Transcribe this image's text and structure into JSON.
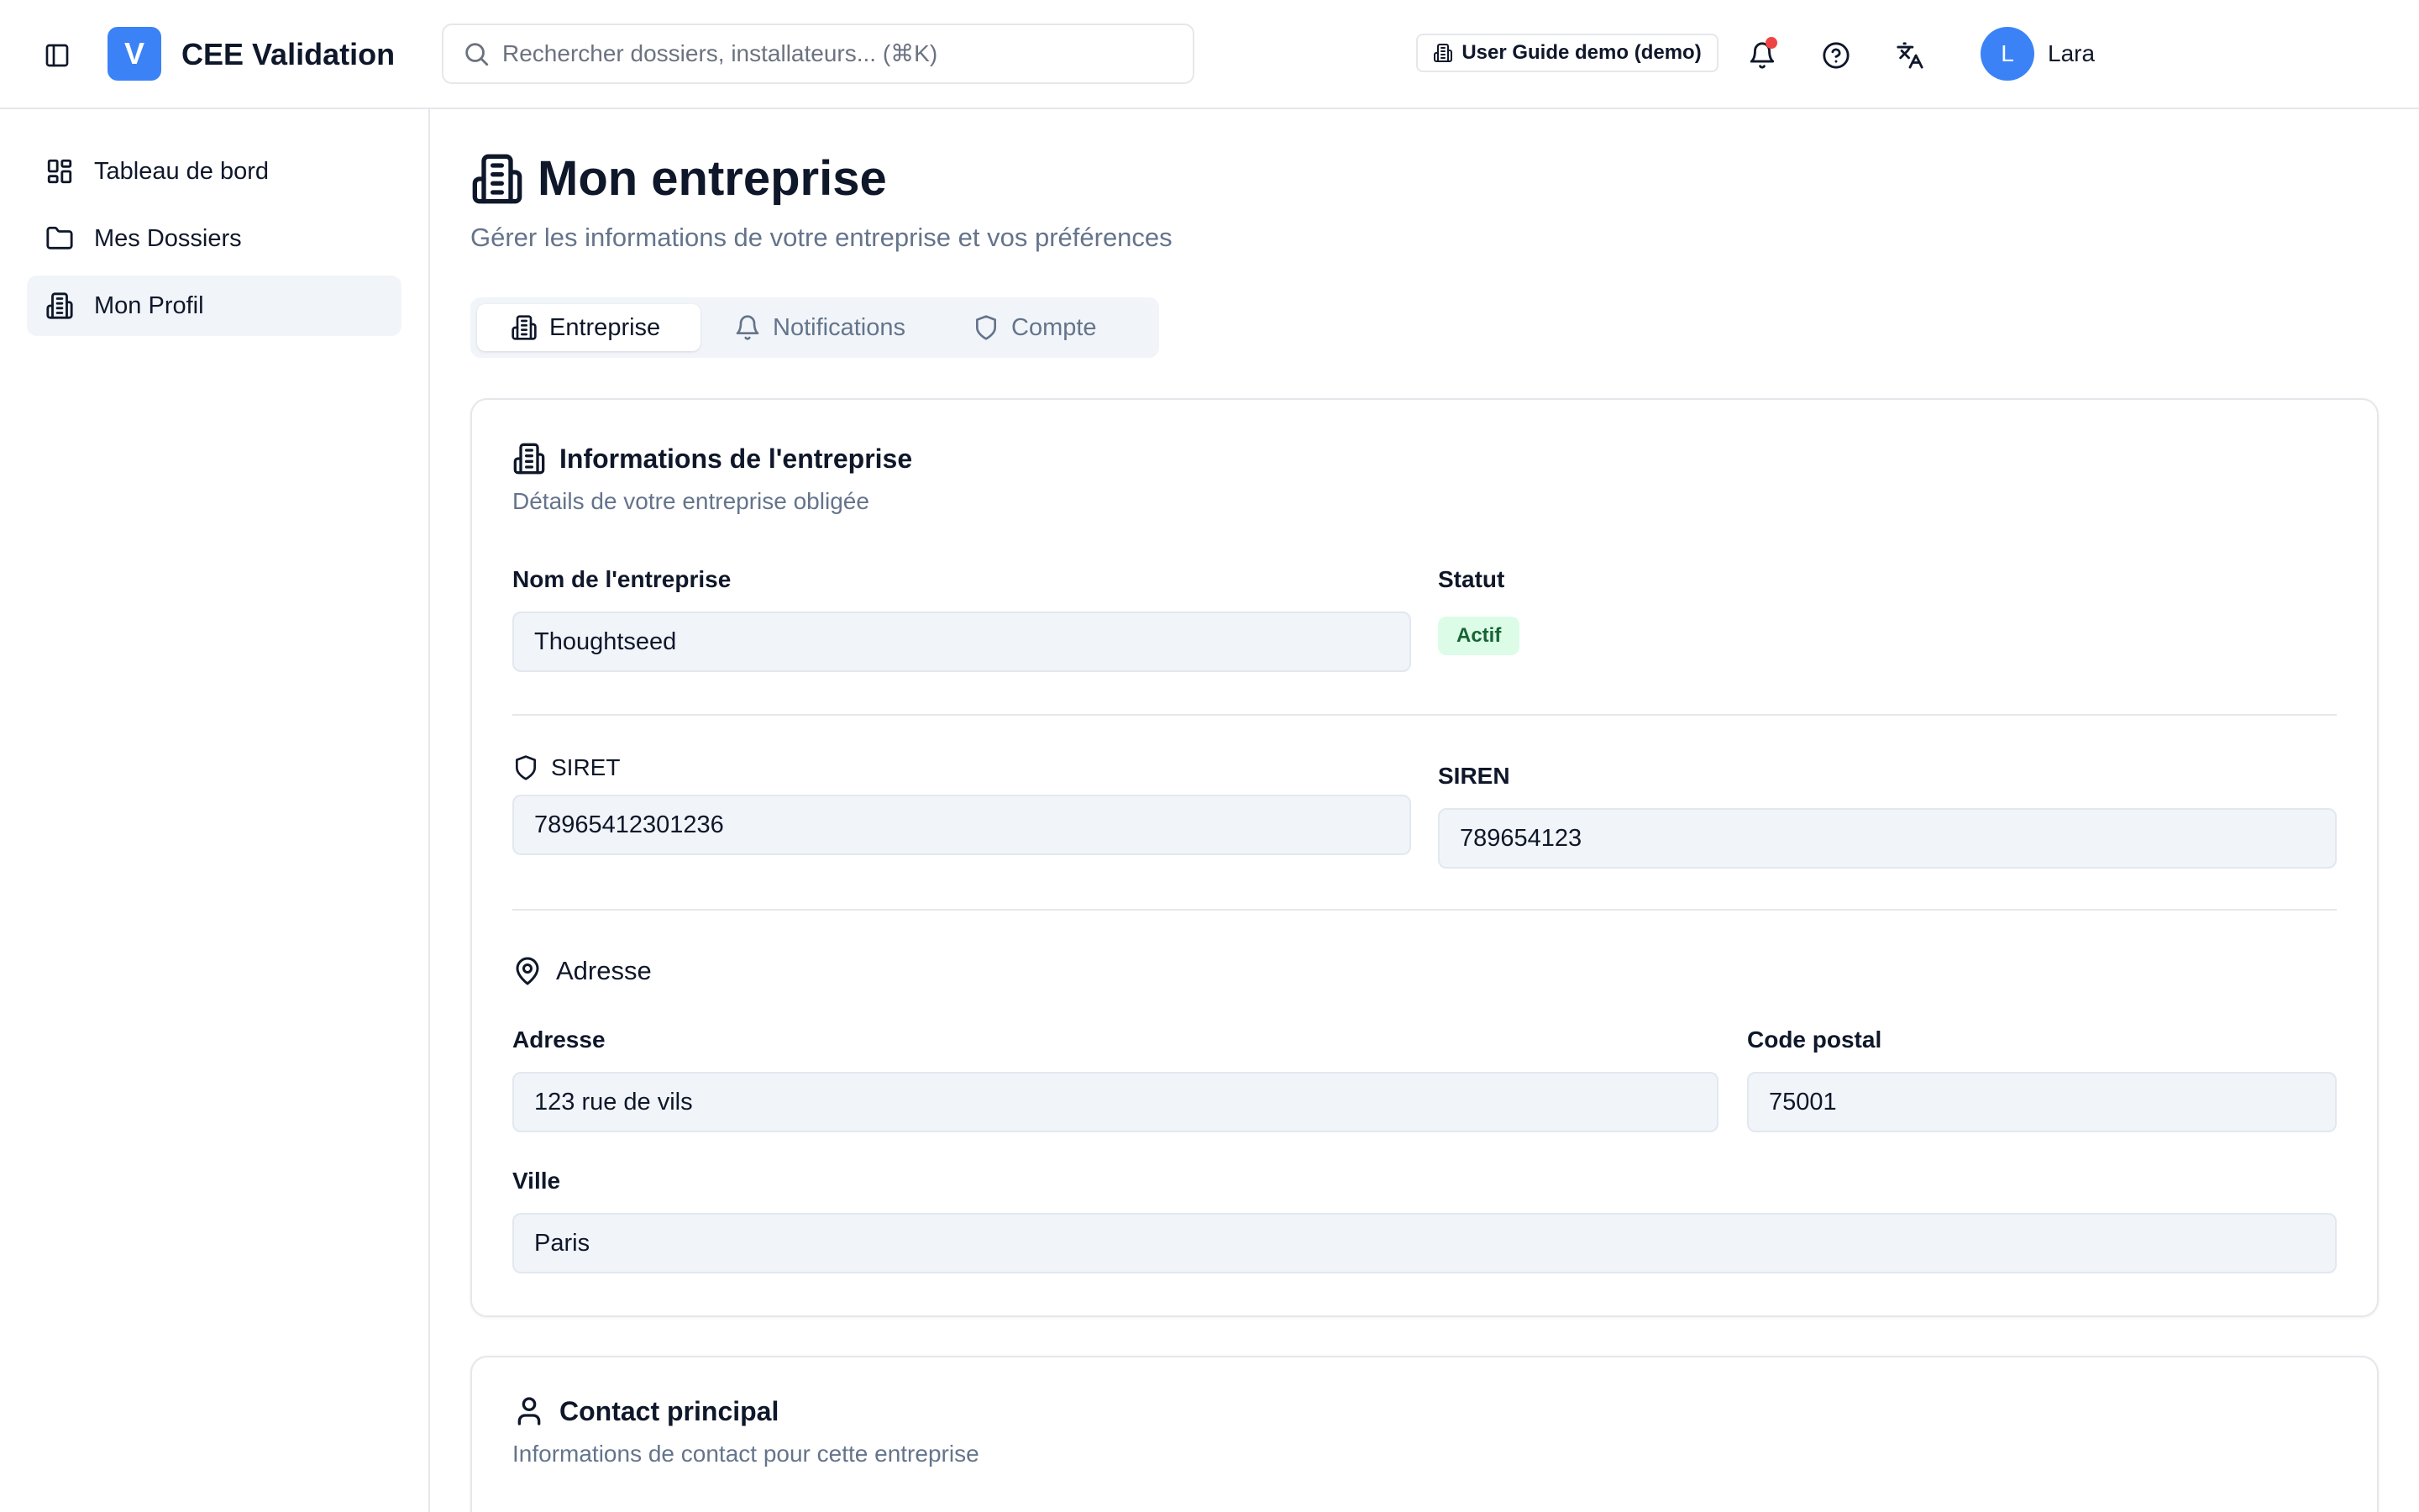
{
  "header": {
    "app_logo_letter": "V",
    "app_title": "CEE Validation",
    "search_placeholder": "Rechercher dossiers, installateurs... (⌘K)",
    "guide_label": "User Guide demo (demo)",
    "user_initial": "L",
    "user_name": "Lara"
  },
  "sidebar": {
    "items": [
      {
        "label": "Tableau de bord",
        "icon": "dashboard-icon"
      },
      {
        "label": "Mes Dossiers",
        "icon": "folder-icon"
      },
      {
        "label": "Mon Profil",
        "icon": "building-icon",
        "active": true
      }
    ]
  },
  "page": {
    "title": "Mon entreprise",
    "subtitle": "Gérer les informations de votre entreprise et vos préférences"
  },
  "tabs": [
    {
      "label": "Entreprise",
      "icon": "building-icon",
      "active": true
    },
    {
      "label": "Notifications",
      "icon": "bell-icon"
    },
    {
      "label": "Compte",
      "icon": "shield-icon"
    }
  ],
  "company_card": {
    "title": "Informations de l'entreprise",
    "description": "Détails de votre entreprise obligée",
    "name_label": "Nom de l'entreprise",
    "name_value": "Thoughtseed",
    "status_label": "Statut",
    "status_value": "Actif",
    "siret_label": "SIRET",
    "siret_value": "78965412301236",
    "siren_label": "SIREN",
    "siren_value": "789654123",
    "address_section": "Adresse",
    "address_label": "Adresse",
    "address_value": "123 rue de vils",
    "postal_label": "Code postal",
    "postal_value": "75001",
    "city_label": "Ville",
    "city_value": "Paris"
  },
  "contact_card": {
    "title": "Contact principal",
    "description": "Informations de contact pour cette entreprise"
  },
  "colors": {
    "accent": "#3b82f6",
    "notification_dot": "#ef4444",
    "badge_bg": "#dcfce7",
    "badge_text": "#166534"
  }
}
